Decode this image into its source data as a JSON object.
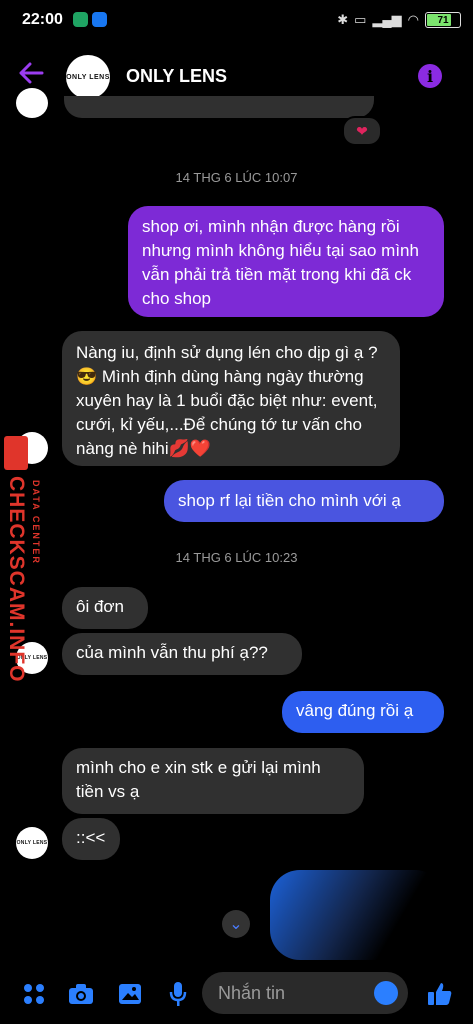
{
  "status": {
    "time": "22:00",
    "battery": "71"
  },
  "header": {
    "title": "ONLY LENS",
    "avatar_text": "ONLY LENS"
  },
  "messages": [
    {
      "type": "stamp",
      "text": "14 THG 6 LÚC 10:07"
    },
    {
      "type": "out",
      "text": "shop ơi, mình nhận được hàng rồi nhưng mình không hiểu tại sao mình vẫn phải trả tiền mặt trong khi đã ck cho shop"
    },
    {
      "type": "in",
      "text": "Nàng iu, định sử dụng lén cho dịp gì ạ ?😎 Mình định dùng hàng ngày thường xuyên hay là 1 buổi đặc biệt như: event, cưới, kỉ yếu,...Để chúng tớ tư vấn cho nàng nè hihi💋❤️"
    },
    {
      "type": "out",
      "text": "shop rf lại tiền cho mình với ạ"
    },
    {
      "type": "stamp",
      "text": "14 THG 6 LÚC 10:23"
    },
    {
      "type": "in",
      "text": "ôi đơn"
    },
    {
      "type": "in",
      "text": "của mình vẫn thu phí ạ??"
    },
    {
      "type": "out",
      "text": "vâng đúng rồi ạ"
    },
    {
      "type": "in",
      "text": "mình cho e xin stk e gửi lại mình tiền vs ạ"
    },
    {
      "type": "in",
      "text": "::<<"
    }
  ],
  "watermark": {
    "text": "CHECKSCAM.INFO",
    "sub": "DATA CENTER"
  },
  "composer": {
    "placeholder": "Nhắn tin"
  },
  "colors": {
    "accent": "#8b2be2",
    "outgoing_purple": "#7d2ad6",
    "outgoing_blue": "#2d5ef0",
    "incoming": "#303030"
  }
}
